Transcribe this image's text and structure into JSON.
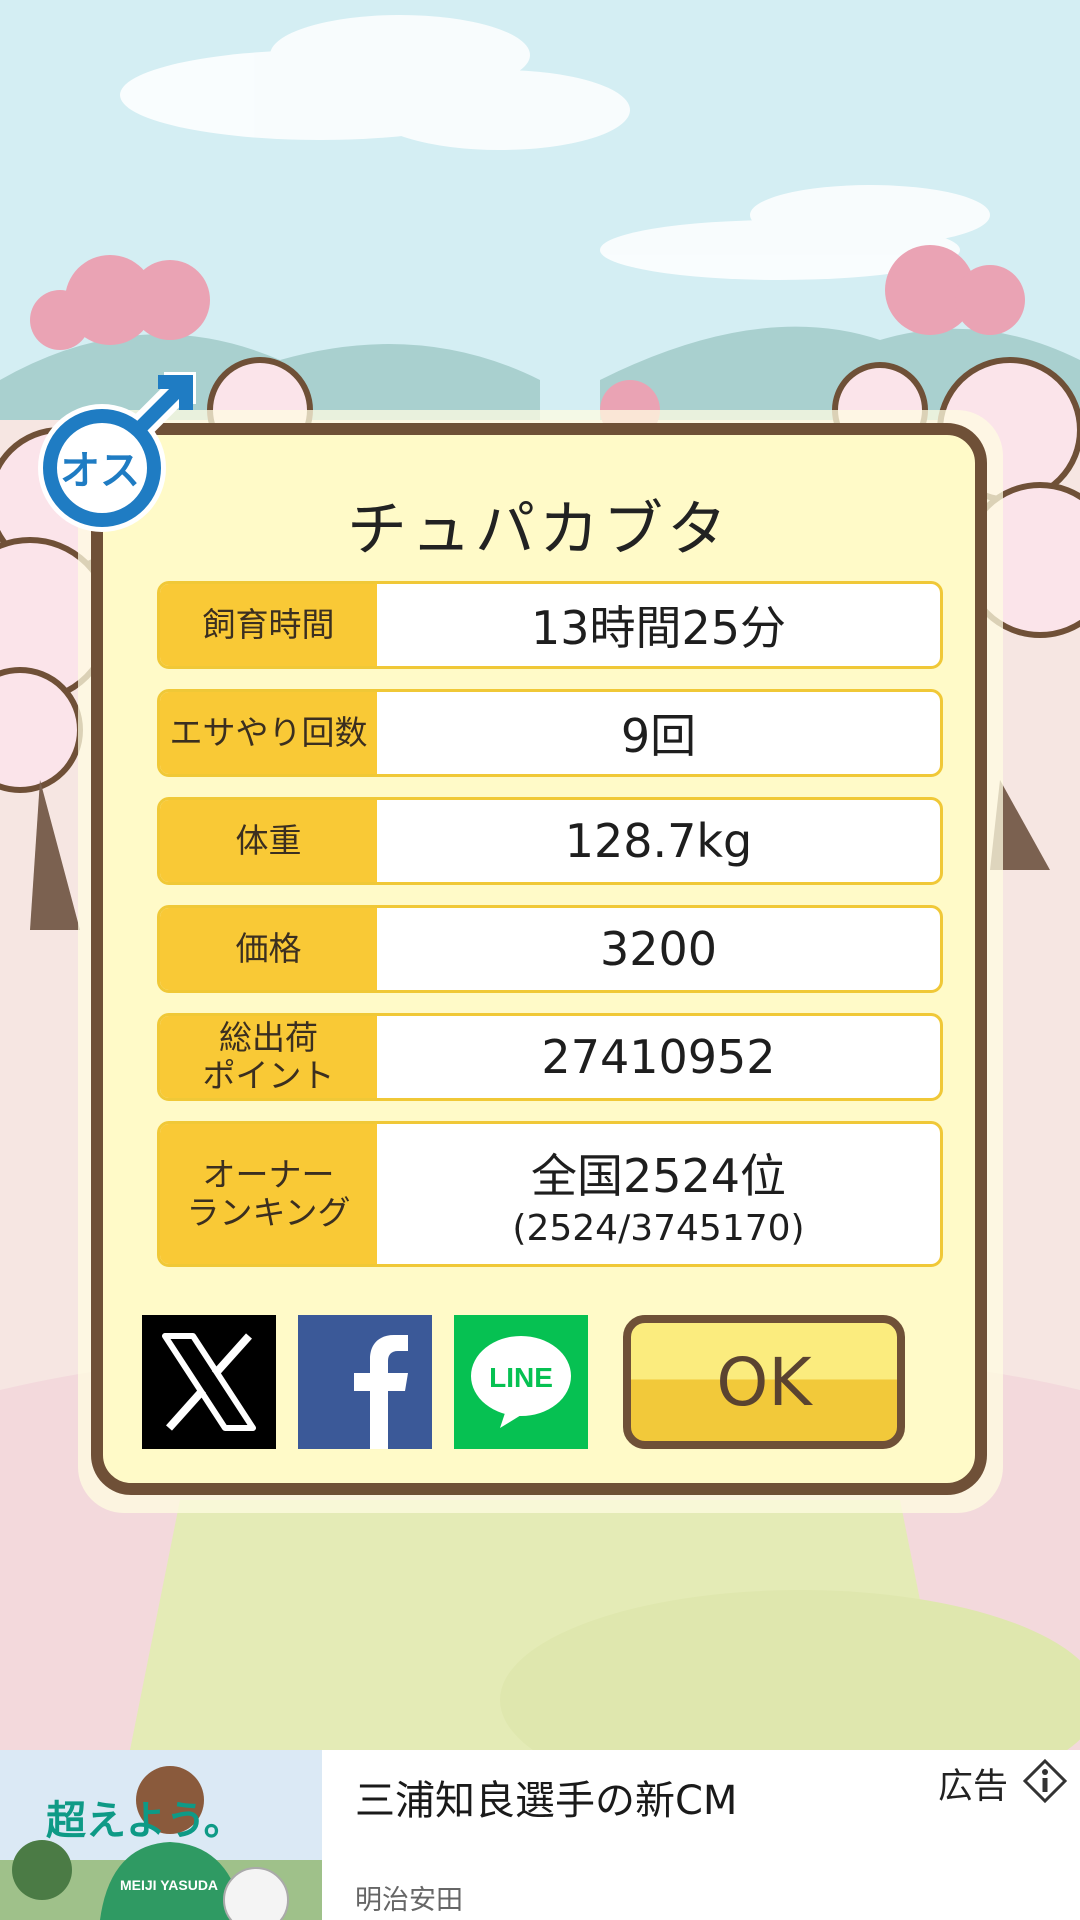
{
  "pig": {
    "name": "チュパカブタ",
    "gender_badge_text": "オス"
  },
  "stats": [
    {
      "label": "飼育時間",
      "value": "13時間25分"
    },
    {
      "label": "エサやり回数",
      "value": "9回"
    },
    {
      "label": "体重",
      "value": "128.7kg"
    },
    {
      "label": "価格",
      "value": "3200"
    },
    {
      "label": "総出荷\nポイント",
      "value": "27410952"
    },
    {
      "label": "オーナー\nランキング",
      "value": "全国2524位",
      "sub": "(2524/3745170)"
    }
  ],
  "share": {
    "x_icon": "x-logo-icon",
    "facebook_icon": "facebook-logo-icon",
    "line_label": "LINE"
  },
  "ok_label": "OK",
  "ad": {
    "headline": "三浦知良選手の新CM",
    "advertiser": "明治安田",
    "label": "広告",
    "image_text": "超えよう。",
    "shirt_text": "MEIJI YASUDA"
  },
  "colors": {
    "frame": "#6f5037",
    "panel": "#fffac8",
    "label_bg": "#f9c936",
    "male_blue": "#1f7cc3",
    "line_green": "#06c152",
    "facebook_blue": "#3b5998"
  }
}
